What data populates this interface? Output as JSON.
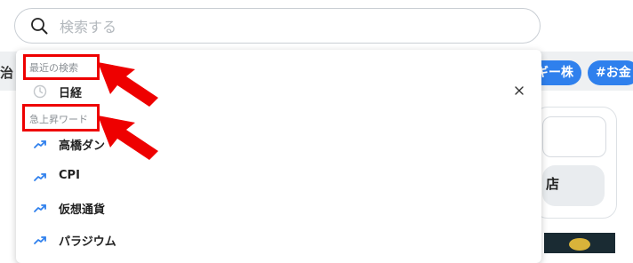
{
  "search": {
    "placeholder": "検索する",
    "value": ""
  },
  "background": {
    "left_text": "治",
    "tags": [
      "ギー株",
      "#お金"
    ],
    "side_button_label": "店"
  },
  "dropdown": {
    "recent_label": "最近の検索",
    "recent_items": [
      {
        "label": "日経",
        "icon": "clock-icon"
      }
    ],
    "trending_label": "急上昇ワード",
    "trending_items": [
      {
        "label": "高橋ダン",
        "icon": "trending-up-icon"
      },
      {
        "label": "CPI",
        "icon": "trending-up-icon"
      },
      {
        "label": "仮想通貨",
        "icon": "trending-up-icon"
      },
      {
        "label": "パラジウム",
        "icon": "trending-up-icon"
      }
    ]
  },
  "colors": {
    "accent": "#2f80ed",
    "highlight": "#ee0000",
    "muted_text": "#8a8f94"
  }
}
